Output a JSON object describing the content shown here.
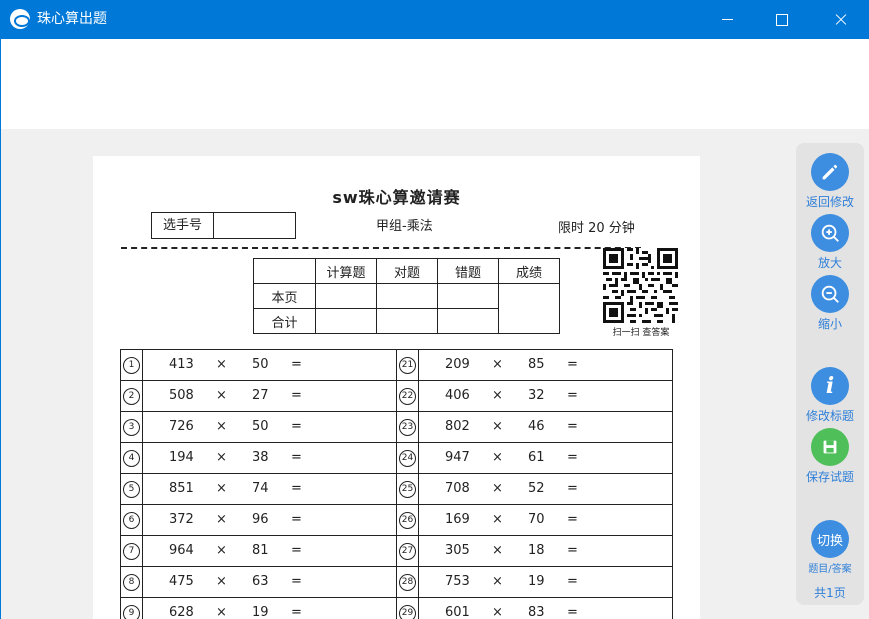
{
  "window": {
    "title": "珠心算出题"
  },
  "paper": {
    "title": "sw珠心算邀请赛",
    "player_label": "选手号",
    "group": "甲组-乘法",
    "time_limit": "限时 20 分钟",
    "qr_caption": "扫一扫 查答案",
    "score": {
      "headers": [
        "计算题",
        "对题",
        "错题",
        "成绩"
      ],
      "rows": [
        "本页",
        "合计"
      ]
    },
    "op_symbol": "×",
    "eq_symbol": "=",
    "questions_left": [
      {
        "n": "1",
        "a": "413",
        "b": "50"
      },
      {
        "n": "2",
        "a": "508",
        "b": "27"
      },
      {
        "n": "3",
        "a": "726",
        "b": "50"
      },
      {
        "n": "4",
        "a": "194",
        "b": "38"
      },
      {
        "n": "5",
        "a": "851",
        "b": "74"
      },
      {
        "n": "6",
        "a": "372",
        "b": "96"
      },
      {
        "n": "7",
        "a": "964",
        "b": "81"
      },
      {
        "n": "8",
        "a": "475",
        "b": "63"
      },
      {
        "n": "9",
        "a": "628",
        "b": "19"
      }
    ],
    "questions_right": [
      {
        "n": "21",
        "a": "209",
        "b": "85"
      },
      {
        "n": "22",
        "a": "406",
        "b": "32"
      },
      {
        "n": "23",
        "a": "802",
        "b": "46"
      },
      {
        "n": "24",
        "a": "947",
        "b": "61"
      },
      {
        "n": "25",
        "a": "708",
        "b": "52"
      },
      {
        "n": "26",
        "a": "169",
        "b": "70"
      },
      {
        "n": "27",
        "a": "305",
        "b": "18"
      },
      {
        "n": "28",
        "a": "753",
        "b": "19"
      },
      {
        "n": "29",
        "a": "601",
        "b": "83"
      }
    ]
  },
  "sidebar": {
    "back_edit": "返回修改",
    "zoom_in": "放大",
    "zoom_out": "缩小",
    "edit_title": "修改标题",
    "save": "保存试题",
    "switch_circle": "切换",
    "switch_label": "题目/答案",
    "page_count": "共1页",
    "icons": [
      "pencil-icon",
      "zoom-in-icon",
      "zoom-out-icon",
      "info-icon",
      "save-icon"
    ],
    "colors": {
      "accent": "#3d8ee0",
      "save": "#4fbf5a",
      "titlebar": "#0078d7"
    }
  }
}
